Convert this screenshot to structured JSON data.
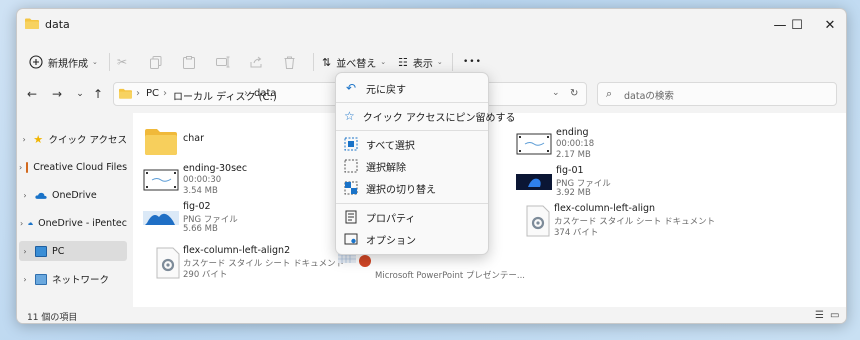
{
  "window": {
    "title": "data"
  },
  "window_controls": {
    "minimize": "—",
    "maximize": "☐",
    "close": "✕"
  },
  "toolbar": {
    "new_label": "新規作成",
    "sort_label": "並べ替え",
    "view_label": "表示",
    "more_label": "•••"
  },
  "address": {
    "crumbs": [
      "PC",
      "ローカル ディスク (C:)",
      "data"
    ],
    "search_placeholder": "dataの検索"
  },
  "sidebar": {
    "items": [
      {
        "label": "クイック アクセス"
      },
      {
        "label": "Creative Cloud Files"
      },
      {
        "label": "OneDrive"
      },
      {
        "label": "OneDrive - iPentec"
      },
      {
        "label": "PC"
      },
      {
        "label": "ネットワーク"
      }
    ]
  },
  "files": {
    "char": {
      "name": "char"
    },
    "ending_30sec": {
      "name": "ending-30sec",
      "meta1": "00:00:30",
      "meta2": "3.54 MB"
    },
    "fig_02": {
      "name": "fig-02",
      "meta1": "PNG ファイル",
      "meta2": "5.66 MB"
    },
    "flex_align2": {
      "name": "flex-column-left-align2",
      "meta1": "カスケード スタイル シート ドキュメント",
      "meta2": "290 バイト"
    },
    "ending": {
      "name": "ending",
      "meta1": "00:00:18",
      "meta2": "2.17 MB"
    },
    "fig_01": {
      "name": "fig-01",
      "meta1": "PNG ファイル",
      "meta2": "3.92 MB"
    },
    "flex_align": {
      "name": "flex-column-left-align",
      "meta1": "カスケード スタイル シート ドキュメント",
      "meta2": "374 バイト"
    },
    "pptx": {
      "meta1": "Microsoft PowerPoint プレゼンテー..."
    }
  },
  "status": {
    "count": "11 個の項目"
  },
  "context_menu": {
    "items": [
      {
        "label": "元に戻す"
      },
      {
        "label": "クイック アクセスにピン留めする"
      },
      {
        "label": "すべて選択"
      },
      {
        "label": "選択解除"
      },
      {
        "label": "選択の切り替え"
      },
      {
        "label": "プロパティ"
      },
      {
        "label": "オプション"
      }
    ]
  },
  "colors": {
    "accent": "#1a73c8",
    "folder": "#f4c542",
    "selected": "#dcdcdc"
  }
}
